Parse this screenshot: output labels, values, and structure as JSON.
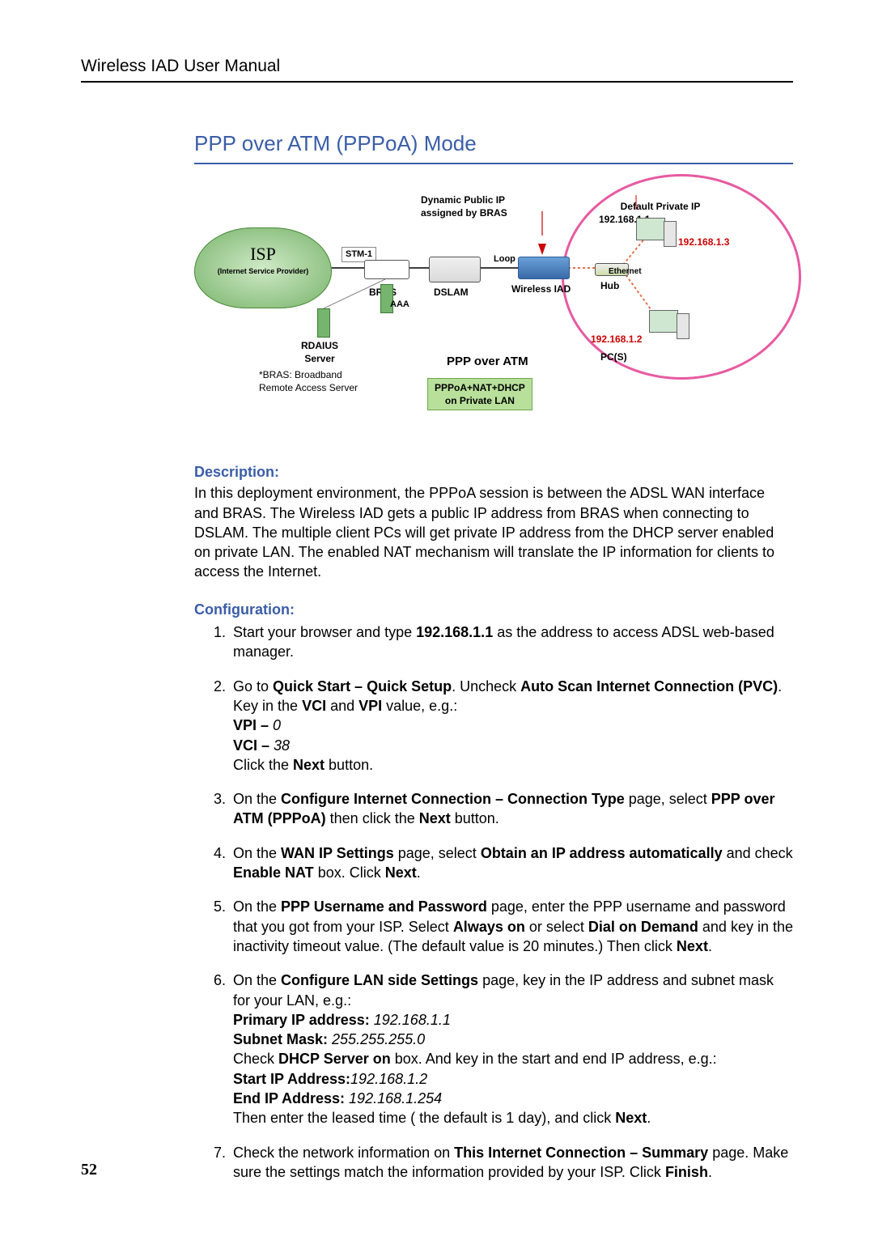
{
  "header": {
    "title": "Wireless IAD User Manual"
  },
  "page_number": "52",
  "section": {
    "title": "PPP over ATM (PPPoA) Mode"
  },
  "diagram": {
    "dynamic_ip": "Dynamic Public IP\nassigned by BRAS",
    "default_ip": "Default Private IP\n192.168.1.1",
    "ip_pc1": "192.168.1.3",
    "ip_pc2": "192.168.1.2",
    "isp": "ISP",
    "isp_sub": "(Internet Service Provider)",
    "stm": "STM-1",
    "loop": "Loop",
    "bras": "BRAS",
    "dslam": "DSLAM",
    "wireless_iad": "Wireless IAD",
    "hub": "Hub",
    "ethernet": "Ethernet",
    "aaa": "AAA",
    "radius": "RDAIUS\nServer",
    "pcs": "PC(S)",
    "ppp_atm": "PPP over ATM",
    "pppoa_box": "PPPoA+NAT+DHCP\non Private LAN",
    "bras_note": "*BRAS: Broadband\nRemote Access Server"
  },
  "labels": {
    "description": "Description:",
    "configuration": "Configuration:"
  },
  "description_text": "In this deployment environment, the PPPoA session is between the ADSL WAN interface and BRAS. The Wireless IAD gets a public IP address from BRAS when connecting to DSLAM. The multiple client PCs will get private IP address from the DHCP server enabled on private LAN. The enabled NAT mechanism will translate the IP information for clients to access the Internet.",
  "steps": {
    "s1_a": "Start your browser and type ",
    "s1_ip": "192.168.1.1",
    "s1_b": " as the address to access ADSL web-based manager.",
    "s2_a": "Go to ",
    "s2_qs": "Quick Start – Quick Setup",
    "s2_b": ". Uncheck ",
    "s2_auto": "Auto Scan Internet Connection (PVC)",
    "s2_c": ". Key in the ",
    "s2_vci": "VCI",
    "s2_and": " and ",
    "s2_vpi": "VPI",
    "s2_d": " value, e.g.:",
    "s2_vpi_l": "VPI – ",
    "s2_vpi_v": "0",
    "s2_vci_l": "VCI – ",
    "s2_vci_v": "38",
    "s2_e": "Click the ",
    "s2_next": "Next",
    "s2_f": " button.",
    "s3_a": "On the ",
    "s3_page": "Configure Internet Connection – Connection Type",
    "s3_b": " page, select ",
    "s3_sel": "PPP over ATM (PPPoA) ",
    "s3_c": "then click the ",
    "s3_next": "Next",
    "s3_d": " button.",
    "s4_a": "On the ",
    "s4_page": "WAN IP Settings",
    "s4_b": " page, select ",
    "s4_sel": "Obtain an IP address automatically",
    "s4_c": " and check ",
    "s4_nat": "Enable NAT",
    "s4_d": " box. Click ",
    "s4_next": "Next",
    "s4_e": ".",
    "s5_a": "On the ",
    "s5_page": "PPP Username and Password",
    "s5_b": " page, enter the PPP username and password that you got from your ISP. Select ",
    "s5_always": "Always on",
    "s5_c": " or select ",
    "s5_dial": "Dial on Demand",
    "s5_d": " and key in the inactivity timeout value. (The default value is 20 minutes.) Then click ",
    "s5_next": "Next",
    "s5_e": ".",
    "s6_a": "On the ",
    "s6_page": "Configure LAN side Settings",
    "s6_b": " page, key in the IP address and subnet mask for your LAN, e.g.:",
    "s6_pip_l": "Primary IP address: ",
    "s6_pip_v": "192.168.1.1",
    "s6_sm_l": "Subnet Mask: ",
    "s6_sm_v": "255.255.255.0",
    "s6_c": "Check ",
    "s6_dhcp": "DHCP Server on",
    "s6_d": " box. And key in the start and end IP address, e.g.:",
    "s6_sip_l": "Start IP Address:",
    "s6_sip_v": "192.168.1.2",
    "s6_eip_l": "End IP Address: ",
    "s6_eip_v": "192.168.1.254",
    "s6_e": "Then enter the leased time ( the default is 1 day), and click ",
    "s6_next": "Next",
    "s6_f": ".",
    "s7_a": "Check the network information on ",
    "s7_page": "This Internet Connection – Summary",
    "s7_b": " page. Make sure the settings match the information provided by your ISP. Click ",
    "s7_fin": "Finish",
    "s7_c": "."
  }
}
